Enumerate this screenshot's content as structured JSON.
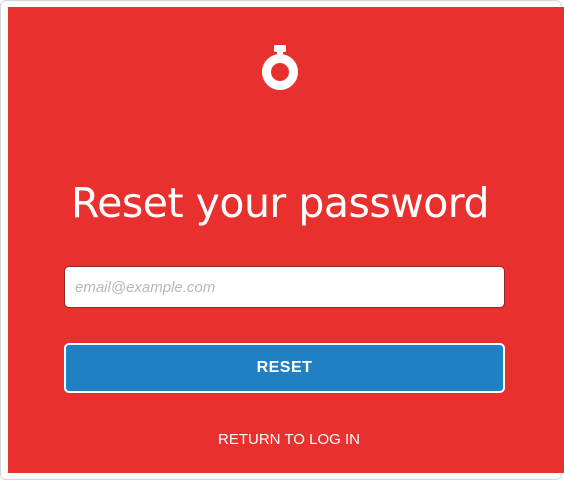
{
  "brand": {
    "logo_icon": "stopwatch-ring-icon",
    "background_color": "#e8312f",
    "button_color": "#1f80c2",
    "text_color": "#ffffff"
  },
  "form": {
    "title": "Reset your password",
    "email_placeholder": "email@example.com",
    "email_value": "",
    "reset_label": "RESET",
    "return_label": "RETURN TO LOG IN"
  }
}
